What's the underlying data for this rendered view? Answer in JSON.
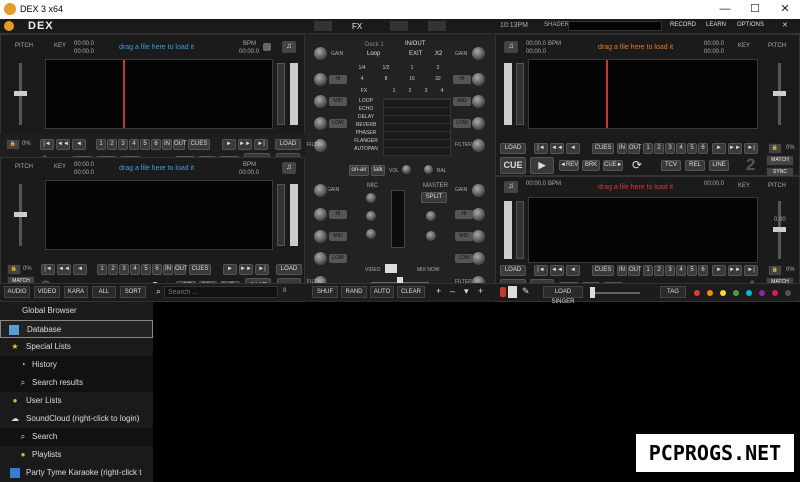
{
  "window": {
    "title": "DEX 3 x64",
    "min": "—",
    "max": "☐",
    "close": "✕"
  },
  "topbar": {
    "logo": "DEX",
    "tabs": [
      "FX"
    ],
    "time": "10:13PM",
    "shader_label": "SHADER",
    "buttons": [
      "RECORD",
      "LEARN",
      "OPTIONS"
    ]
  },
  "deck": {
    "pitch": "PITCH",
    "key": "KEY",
    "bpm": "BPM",
    "time_zero": "00:00.0",
    "placeholder": "drag a file here to load it",
    "percent": "0%",
    "pitch_val": "0.00",
    "match": "MATCH",
    "sync": "SYNC",
    "load": "LOAD",
    "cues": "CUES",
    "tcv": "TCV",
    "rel": "REL",
    "line": "LINE",
    "rev": "◄REV",
    "brk": "BRK",
    "cuep": "CUE►",
    "cue": "CUE",
    "play": "▶",
    "in": "IN",
    "out": "OUT",
    "hotcues": [
      "1",
      "2",
      "3",
      "4",
      "5",
      "6"
    ],
    "numbers": [
      "1",
      "2",
      "3",
      "4"
    ]
  },
  "mixer": {
    "deck_label": "Deck 1",
    "loop": "Loop",
    "inout": "IN/OUT",
    "exit": "EXIT",
    "x2": "X2",
    "gain": "GAIN",
    "hi": "HI",
    "mid": "MID",
    "low": "LOW",
    "filter": "FILTER",
    "loop_sizes": [
      "1/4",
      "1/2",
      "1",
      "2",
      "4",
      "8",
      "16",
      "32"
    ],
    "fx_row": [
      "FX",
      "1",
      "2",
      "3",
      "4"
    ],
    "fx_list": [
      "LOOP",
      "ECHO",
      "DELAY",
      "REVERB",
      "PHASER",
      "FLANGER",
      "AUTOPAN"
    ],
    "onair": "on-air",
    "talk": "talk",
    "vol": "VOL",
    "bal": "BAL",
    "mic": "MIC",
    "master": "MASTER",
    "split": "SPLIT",
    "video": "VIDEO",
    "mix_now": "MIX NOW"
  },
  "browserbar": {
    "left": [
      "AUDIO",
      "VIDEO",
      "KARA",
      "ALL",
      "SORT"
    ],
    "search_placeholder": "Search ...",
    "search_count": "8",
    "mid": [
      "SHUF",
      "RAND",
      "AUTO",
      "CLEAR"
    ],
    "plusminus": [
      "+",
      "–",
      "▾",
      "+"
    ],
    "load_singer": "LOAD SINGER",
    "tag": "TAG",
    "colors": [
      "#e53935",
      "#fb8c00",
      "#fdd835",
      "#43a047",
      "#00bcd4",
      "#8e24aa",
      "#d81b60",
      "#555555"
    ]
  },
  "sidebar": {
    "header": "Global Browser",
    "items": [
      {
        "label": "Database",
        "icon": "▭"
      },
      {
        "label": "Special Lists",
        "icon": "★"
      },
      {
        "label": "History",
        "icon": "◔"
      },
      {
        "label": "Search results",
        "icon": "🔍"
      },
      {
        "label": "User Lists",
        "icon": "👤"
      },
      {
        "label": "SoundCloud (right-click to login)",
        "icon": "☁"
      },
      {
        "label": "Search",
        "icon": "🔍"
      },
      {
        "label": "Playlists",
        "icon": "👤"
      },
      {
        "label": "Party Tyme Karaoke (right-click t",
        "icon": "▮"
      }
    ]
  },
  "watermark": "PCPROGS.NET"
}
